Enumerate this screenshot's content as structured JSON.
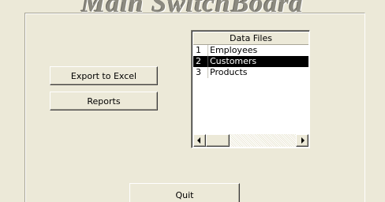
{
  "form": {
    "title": "Main SwitchBoard"
  },
  "buttons": {
    "export_label": "Export to Excel",
    "reports_label": "Reports",
    "quit_label": "Quit"
  },
  "data_files": {
    "header": "Data Files",
    "rows": [
      {
        "id": "1",
        "name": "Employees",
        "selected": false
      },
      {
        "id": "2",
        "name": "Customers",
        "selected": true
      },
      {
        "id": "3",
        "name": "Products",
        "selected": false
      }
    ]
  },
  "icons": {
    "scroll_left": "arrow-left-icon",
    "scroll_right": "arrow-right-icon"
  },
  "colors": {
    "background": "#ece9d8",
    "selection": "#000000",
    "selection_text": "#ffffff"
  }
}
